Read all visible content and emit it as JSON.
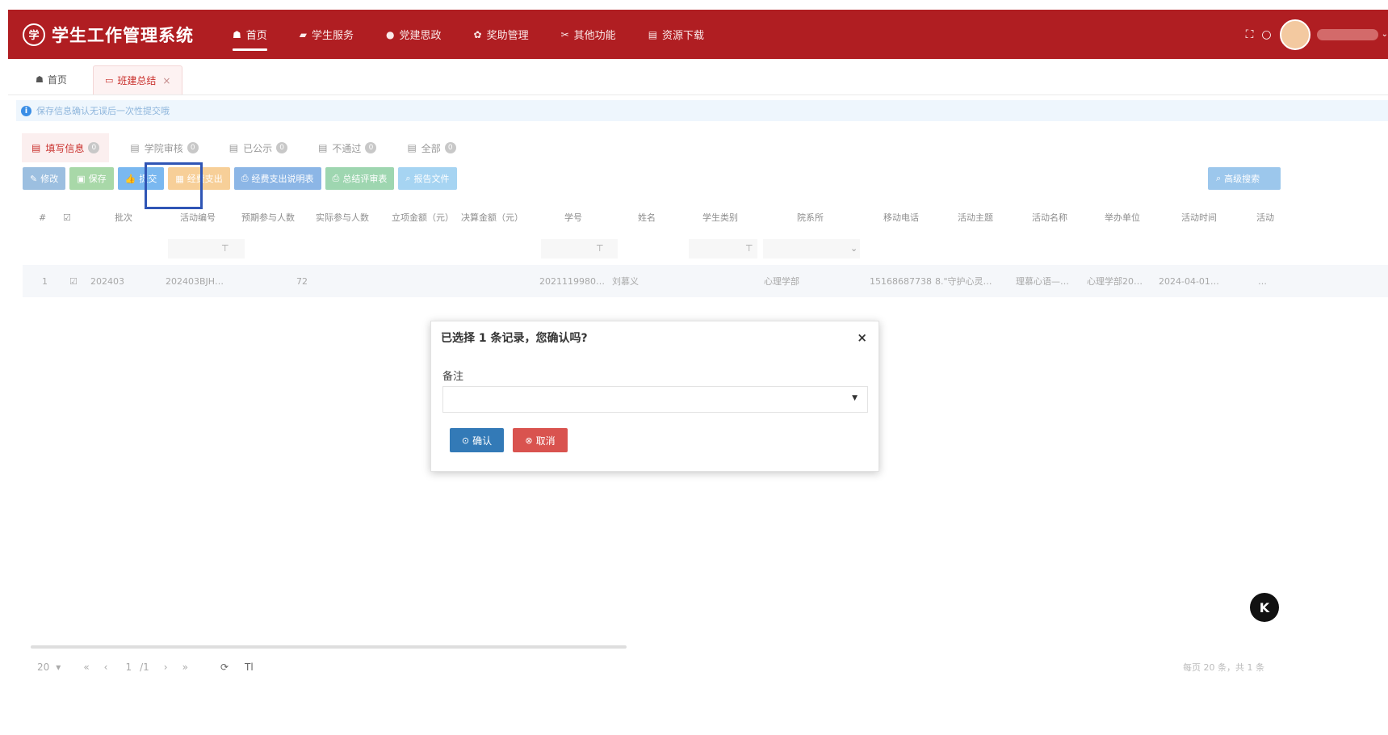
{
  "header": {
    "app_title": "学生工作管理系统",
    "logo_glyph": "学",
    "nav": [
      {
        "label": "首页",
        "icon": "home-icon",
        "glyph": "☗",
        "active": true
      },
      {
        "label": "学生服务",
        "icon": "graduation-cap-icon",
        "glyph": "▰",
        "active": false
      },
      {
        "label": "党建思政",
        "icon": "info-circle-icon",
        "glyph": "●",
        "active": false
      },
      {
        "label": "奖助管理",
        "icon": "award-icon",
        "glyph": "✿",
        "active": false
      },
      {
        "label": "其他功能",
        "icon": "tools-icon",
        "glyph": "✂",
        "active": false
      },
      {
        "label": "资源下载",
        "icon": "document-icon",
        "glyph": "▤",
        "active": false
      }
    ],
    "fullscreen_glyph": "⛶",
    "refresh_glyph": "○",
    "caret_glyph": "⌄"
  },
  "page_tabs": {
    "home_label": "首页",
    "current_label": "班建总结",
    "close_glyph": "×"
  },
  "info": {
    "glyph": "i",
    "text": "保存信息确认无误后一次性提交哦"
  },
  "status_tabs": [
    {
      "label": "填写信息",
      "count": "0",
      "active": true
    },
    {
      "label": "学院审核",
      "count": "0",
      "active": false
    },
    {
      "label": "已公示",
      "count": "0",
      "active": false
    },
    {
      "label": "不通过",
      "count": "0",
      "active": false
    },
    {
      "label": "全部",
      "count": "0",
      "active": false
    }
  ],
  "toolbar": {
    "buttons": [
      {
        "label": "修改",
        "glyph": "✎",
        "color": "#9cbfe0"
      },
      {
        "label": "保存",
        "glyph": "▣",
        "color": "#a8d8a8"
      },
      {
        "label": "提交",
        "glyph": "👍",
        "color": "#7ab8f0"
      },
      {
        "label": "经费支出",
        "glyph": "▦",
        "color": "#f7cf98"
      },
      {
        "label": "经费支出说明表",
        "glyph": "⎙",
        "color": "#8cb6e6"
      },
      {
        "label": "总结评审表",
        "glyph": "⎙",
        "color": "#9ed6b0"
      },
      {
        "label": "报告文件",
        "glyph": "⌕",
        "color": "#a6d4f2"
      }
    ],
    "search_label": "高级搜索",
    "search_glyph": "⌕"
  },
  "table": {
    "columns": [
      "#",
      "☑",
      "批次",
      "活动编号",
      "预期参与人数",
      "实际参与人数",
      "立项金额（元）",
      "决算金额（元）",
      "学号",
      "姓名",
      "学生类别",
      "院系所",
      "移动电话",
      "活动主题",
      "活动名称",
      "举办单位",
      "活动时间",
      "活动"
    ],
    "filter_glyph": "⊤",
    "filter_caret": "⌄",
    "rows": [
      {
        "cells": [
          "1",
          "☑",
          "202403",
          "202403BJH…",
          "72",
          "",
          "",
          "",
          "2021119980…",
          "刘慕义",
          "",
          "心理学部",
          "15168687738",
          "8.\"守护心灵…",
          "理慕心语—…",
          "心理学部20…",
          "2024-04-01…",
          "…"
        ]
      }
    ]
  },
  "modal": {
    "title": "已选择 1 条记录，您确认吗?",
    "close_glyph": "×",
    "remark_label": "备注",
    "select_value": "",
    "select_caret": "▼",
    "ok_label": "确认",
    "cancel_label": "取消",
    "ok_glyph": "⊙",
    "cancel_glyph": "⊗"
  },
  "float_button": {
    "label": "K"
  },
  "footer": {
    "page_size": "20",
    "page_size_caret": "▾",
    "first": "«",
    "prev": "‹",
    "current_page": "1",
    "total_pages": "/1",
    "next": "›",
    "last": "»",
    "refresh": "⟳",
    "columns_toggle": "Tl",
    "summary": "每页 20 条，共 1 条"
  },
  "colors": {
    "brand_red": "#b01e22",
    "highlight_blue": "#2f55b5",
    "ok_blue": "#337ab7",
    "cancel_red": "#d9534f"
  }
}
